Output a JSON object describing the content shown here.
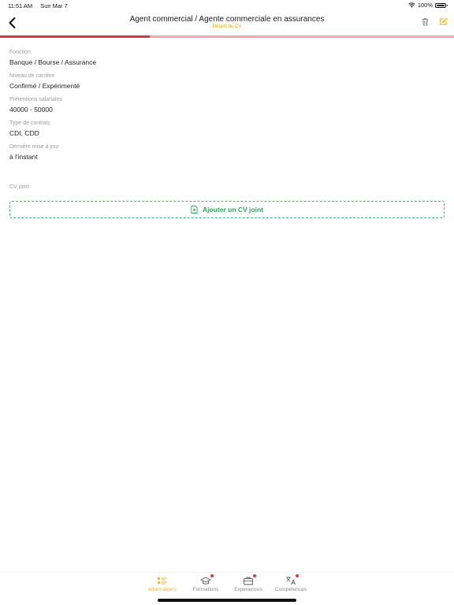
{
  "status_bar": {
    "time": "11:51 AM",
    "date": "Sun Mar 7",
    "battery": "100%"
  },
  "header": {
    "title": "Agent commercial / Agente commerciale en assurances",
    "subtitle": "Détails du CV"
  },
  "progress": {
    "fraction": 0.33
  },
  "fields": [
    {
      "label": "Fonction",
      "value": "Banque / Bourse / Assurance"
    },
    {
      "label": "Niveau de carrière",
      "value": "Confirmé / Expérimenté"
    },
    {
      "label": "Prétentions salariales",
      "value": "40000 - 50000"
    },
    {
      "label": "Type de contrats",
      "value": "CDI, CDD"
    },
    {
      "label": "Dernière mise à jour",
      "value": "à l'instant"
    }
  ],
  "cv": {
    "label": "CV joint",
    "add_label": "Ajouter un CV joint"
  },
  "tabs": [
    {
      "label": "Informations",
      "icon": "list-icon",
      "active": true,
      "badge": false
    },
    {
      "label": "Formations",
      "icon": "graduation-cap-icon",
      "active": false,
      "badge": true
    },
    {
      "label": "Experiences",
      "icon": "briefcase-icon",
      "active": false,
      "badge": true
    },
    {
      "label": "Compétences",
      "icon": "translate-icon",
      "active": false,
      "badge": true
    }
  ],
  "colors": {
    "accent": "#d53845",
    "accent_light": "#f0a8ac",
    "subtitle": "#e0a800",
    "active_tab": "#f3b13a",
    "success": "#2fa55d",
    "badge": "#e53935"
  }
}
